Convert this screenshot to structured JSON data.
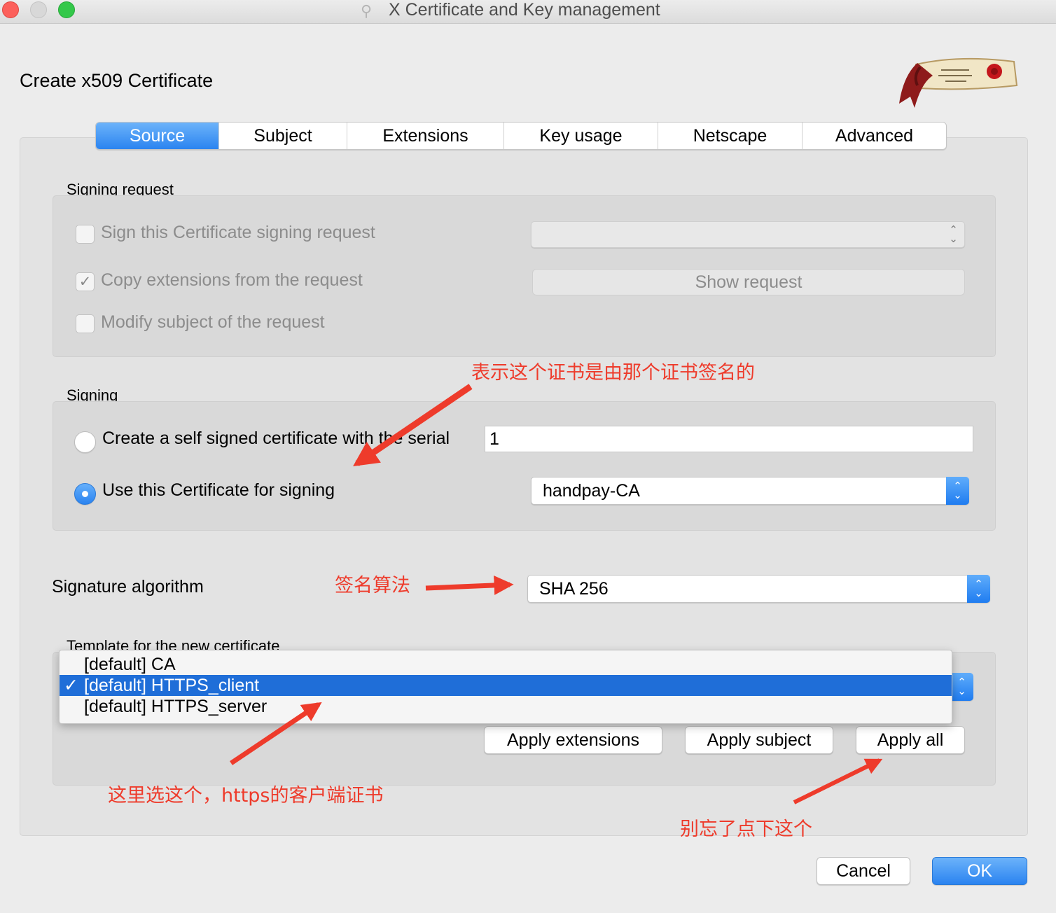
{
  "window": {
    "title": "X Certificate and Key management"
  },
  "dialog": {
    "title": "Create x509 Certificate"
  },
  "tabs": [
    "Source",
    "Subject",
    "Extensions",
    "Key usage",
    "Netscape",
    "Advanced"
  ],
  "signing_request": {
    "label": "Signing request",
    "sign_csr_label": "Sign this Certificate signing request",
    "sign_csr_checked": false,
    "copy_extensions_label": "Copy extensions from the request",
    "copy_extensions_checked": true,
    "modify_subject_label": "Modify subject of the request",
    "modify_subject_checked": false,
    "csr_select_value": "",
    "show_request_label": "Show request"
  },
  "signing": {
    "label": "Signing",
    "self_signed_label": "Create a self signed certificate with the serial",
    "serial_value": "1",
    "use_cert_label": "Use this Certificate for signing",
    "ca_select_value": "handpay-CA",
    "selected_option": "use_cert"
  },
  "signature_algorithm": {
    "label": "Signature algorithm",
    "value": "SHA 256"
  },
  "template": {
    "label": "Template for the new certificate",
    "options": [
      "[default] CA",
      "[default] HTTPS_client",
      "[default] HTTPS_server"
    ],
    "selected_index": 1,
    "apply_extensions_label": "Apply extensions",
    "apply_subject_label": "Apply subject",
    "apply_all_label": "Apply all"
  },
  "footer": {
    "cancel_label": "Cancel",
    "ok_label": "OK"
  },
  "annotations": {
    "signer_note": "表示这个证书是由那个证书签名的",
    "algorithm_note": "签名算法",
    "template_note": "这里选这个，https的客户端证书",
    "apply_all_note": "别忘了点下这个"
  },
  "colors": {
    "accent": "#2a83f0",
    "annotation": "#ee3b2b"
  }
}
